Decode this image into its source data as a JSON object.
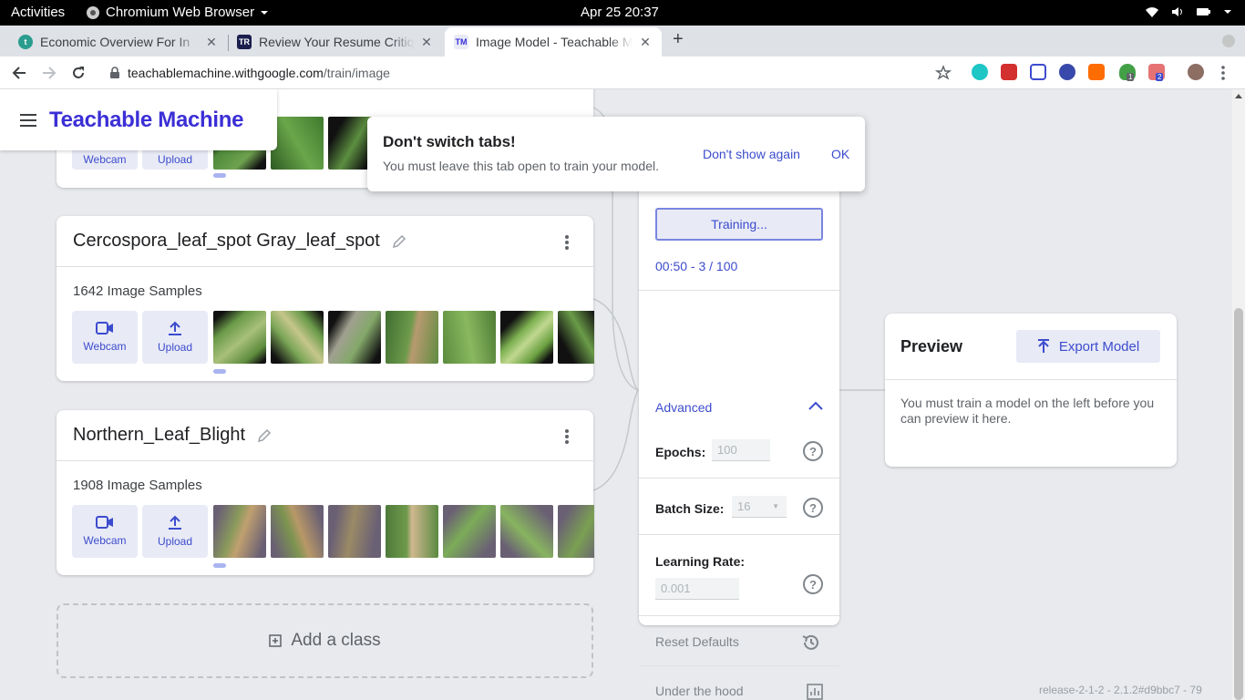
{
  "system_bar": {
    "activities": "Activities",
    "app_name": "Chromium Web Browser",
    "clock": "Apr 25  20:37"
  },
  "tabs": [
    {
      "title": "Economic Overview For In",
      "favicon": "t",
      "favicon_color": "#2a9d8f"
    },
    {
      "title": "Review Your Resume Critiq",
      "favicon": "TR",
      "favicon_color": "#1a1f4e"
    },
    {
      "title": "Image Model - Teachable M",
      "favicon": "TM",
      "favicon_color": "#e8eaf6"
    }
  ],
  "omnibox": {
    "host": "teachablemachine.withgoogle.com",
    "path": "/train/image"
  },
  "extension_badges": [
    "1",
    "2"
  ],
  "app": {
    "brand": "Teachable Machine"
  },
  "classes": [
    {
      "name": "",
      "samples": "",
      "webcam_label": "Webcam",
      "upload_label": "Upload"
    },
    {
      "name": "Cercospora_leaf_spot Gray_leaf_spot",
      "samples": "1642 Image Samples",
      "webcam_label": "Webcam",
      "upload_label": "Upload"
    },
    {
      "name": "Northern_Leaf_Blight",
      "samples": "1908 Image Samples",
      "webcam_label": "Webcam",
      "upload_label": "Upload"
    }
  ],
  "add_class_label": "Add a class",
  "popup": {
    "title": "Don't switch tabs!",
    "body": "You must leave this tab open to train your model.",
    "dont_show": "Don't show again",
    "ok": "OK"
  },
  "training": {
    "button_label": "Training...",
    "progress": "00:50 - 3 / 100",
    "advanced_label": "Advanced",
    "epochs_label": "Epochs:",
    "epochs_value": "100",
    "batch_label": "Batch Size:",
    "batch_value": "16",
    "lr_label": "Learning Rate:",
    "lr_value": "0.001",
    "reset_label": "Reset Defaults",
    "hood_label": "Under the hood"
  },
  "preview": {
    "title": "Preview",
    "export_label": "Export Model",
    "message": "You must train a model on the left before you can preview it here."
  },
  "release": "release-2-1-2 - 2.1.2#d9bbc7 - 79",
  "colors": {
    "accent": "#3c4ccd",
    "brand": "#3b2fd6",
    "leaf": "#4f8a3a"
  }
}
